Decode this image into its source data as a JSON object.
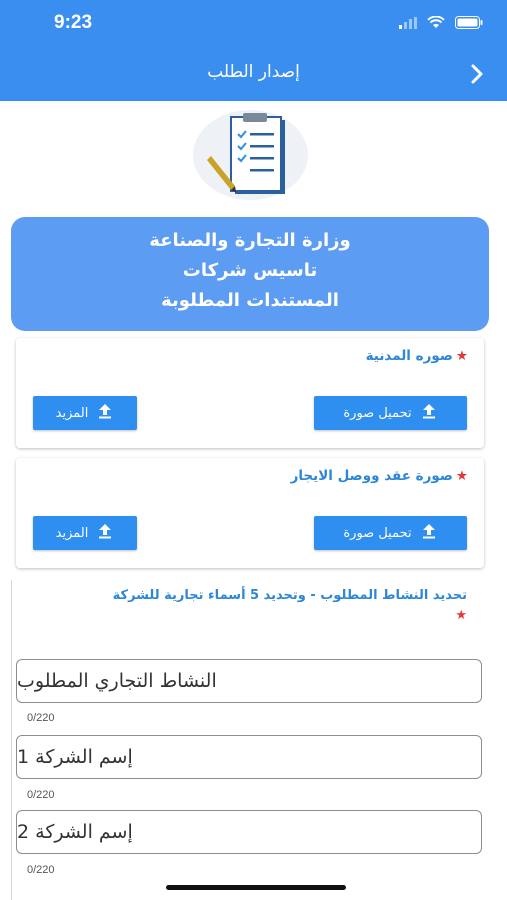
{
  "status_bar": {
    "time": "9:23"
  },
  "nav": {
    "title": "إصدار الطلب"
  },
  "header": {
    "line1": "وزارة التجارة والصناعة",
    "line2": "تاسيس شركات",
    "line3": "المستندات المطلوبة"
  },
  "sections": [
    {
      "label": "صوره المدنية",
      "upload_label": "تحميل صورة",
      "more_label": "المزيد"
    },
    {
      "label": "صورة عقد ووصل الايجار",
      "upload_label": "تحميل صورة",
      "more_label": "المزيد"
    }
  ],
  "activity": {
    "label": "تحديد النشاط المطلوب - وتحديد 5 أسماء تجارية للشركة"
  },
  "fields": [
    {
      "placeholder": "النشاط التجاري المطلوب",
      "counter": "0/220"
    },
    {
      "placeholder": "إسم الشركة 1",
      "counter": "0/220"
    },
    {
      "placeholder": "إسم الشركة 2",
      "counter": "0/220"
    }
  ],
  "colors": {
    "primary": "#3a8eef",
    "header_card": "#5c9cf2",
    "label": "#2d86d6",
    "required": "#e53935"
  },
  "icons": [
    "wifi-icon",
    "battery-icon",
    "chevron-right-icon",
    "clipboard-logo-icon",
    "upload-icon"
  ]
}
